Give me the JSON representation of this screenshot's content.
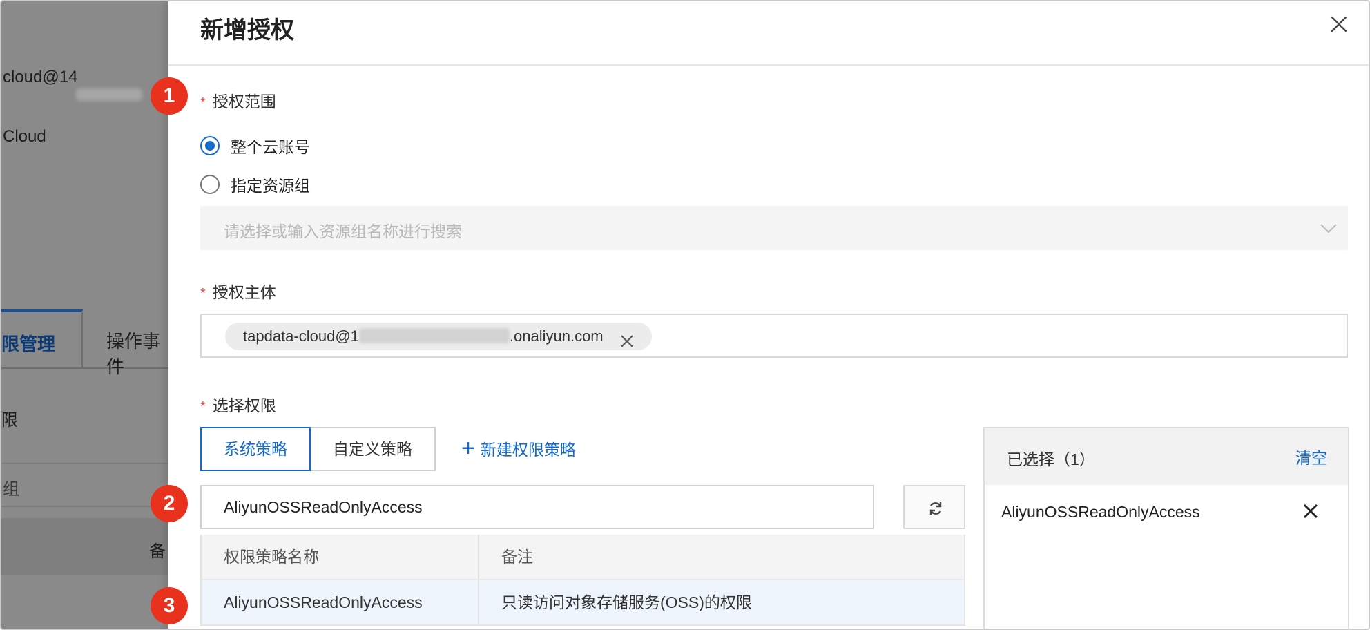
{
  "background": {
    "account_line": "cloud@14",
    "cloud_label": "Cloud",
    "tab_active": "限管理",
    "tab_other": "操作事件",
    "text_1": "限",
    "text_2": "组",
    "text_3": "备"
  },
  "dialog": {
    "title": "新增授权",
    "close_icon": "close-icon"
  },
  "scope": {
    "label": "授权范围",
    "required_mark": "*",
    "options": [
      {
        "label": "整个云账号",
        "checked": true
      },
      {
        "label": "指定资源组",
        "checked": false
      }
    ],
    "resource_group_placeholder": "请选择或输入资源组名称进行搜索"
  },
  "principal": {
    "label": "授权主体",
    "required_mark": "*",
    "tag_prefix": "tapdata-cloud@1",
    "tag_suffix": ".onaliyun.com"
  },
  "permissions": {
    "label": "选择权限",
    "required_mark": "*",
    "tabs": [
      "系统策略",
      "自定义策略"
    ],
    "active_tab": "系统策略",
    "new_policy_label": "新建权限策略",
    "search_value": "AliyunOSSReadOnlyAccess",
    "table": {
      "headers": [
        "权限策略名称",
        "备注"
      ],
      "rows": [
        {
          "name": "AliyunOSSReadOnlyAccess",
          "note": "只读访问对象存储服务(OSS)的权限"
        }
      ]
    }
  },
  "selected": {
    "title": "已选择（1）",
    "clear_label": "清空",
    "items": [
      "AliyunOSSReadOnlyAccess"
    ]
  },
  "badges": [
    "1",
    "2",
    "3"
  ],
  "colors": {
    "accent": "#1569c7",
    "required": "#e84a4a",
    "badge": "#e8321e"
  }
}
